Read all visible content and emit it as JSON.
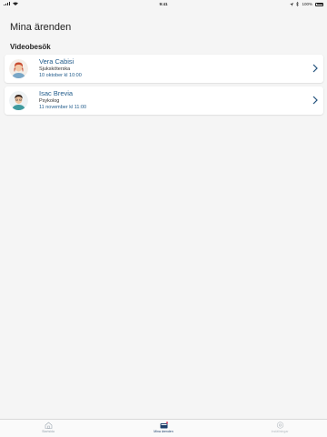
{
  "status": {
    "time": "9:41",
    "battery": "100%"
  },
  "page": {
    "title": "Mina ärenden"
  },
  "section": {
    "title": "Videobesök"
  },
  "appointments": [
    {
      "name": "Vera Cabisi",
      "role": "Sjuksköterska",
      "date": "10 oktober kl 10:00"
    },
    {
      "name": "Isac Brevia",
      "role": "Psykolog",
      "date": "11 november kl 11:00"
    }
  ],
  "tabs": [
    {
      "label": "Startsida",
      "icon": "home-icon"
    },
    {
      "label": "Mina ärenden",
      "icon": "inbox-icon"
    },
    {
      "label": "Inställningar",
      "icon": "gear-icon"
    }
  ],
  "colors": {
    "accent": "#1f5a8a",
    "active_tab": "#1f3f6a",
    "badge": "#e05a7a"
  }
}
